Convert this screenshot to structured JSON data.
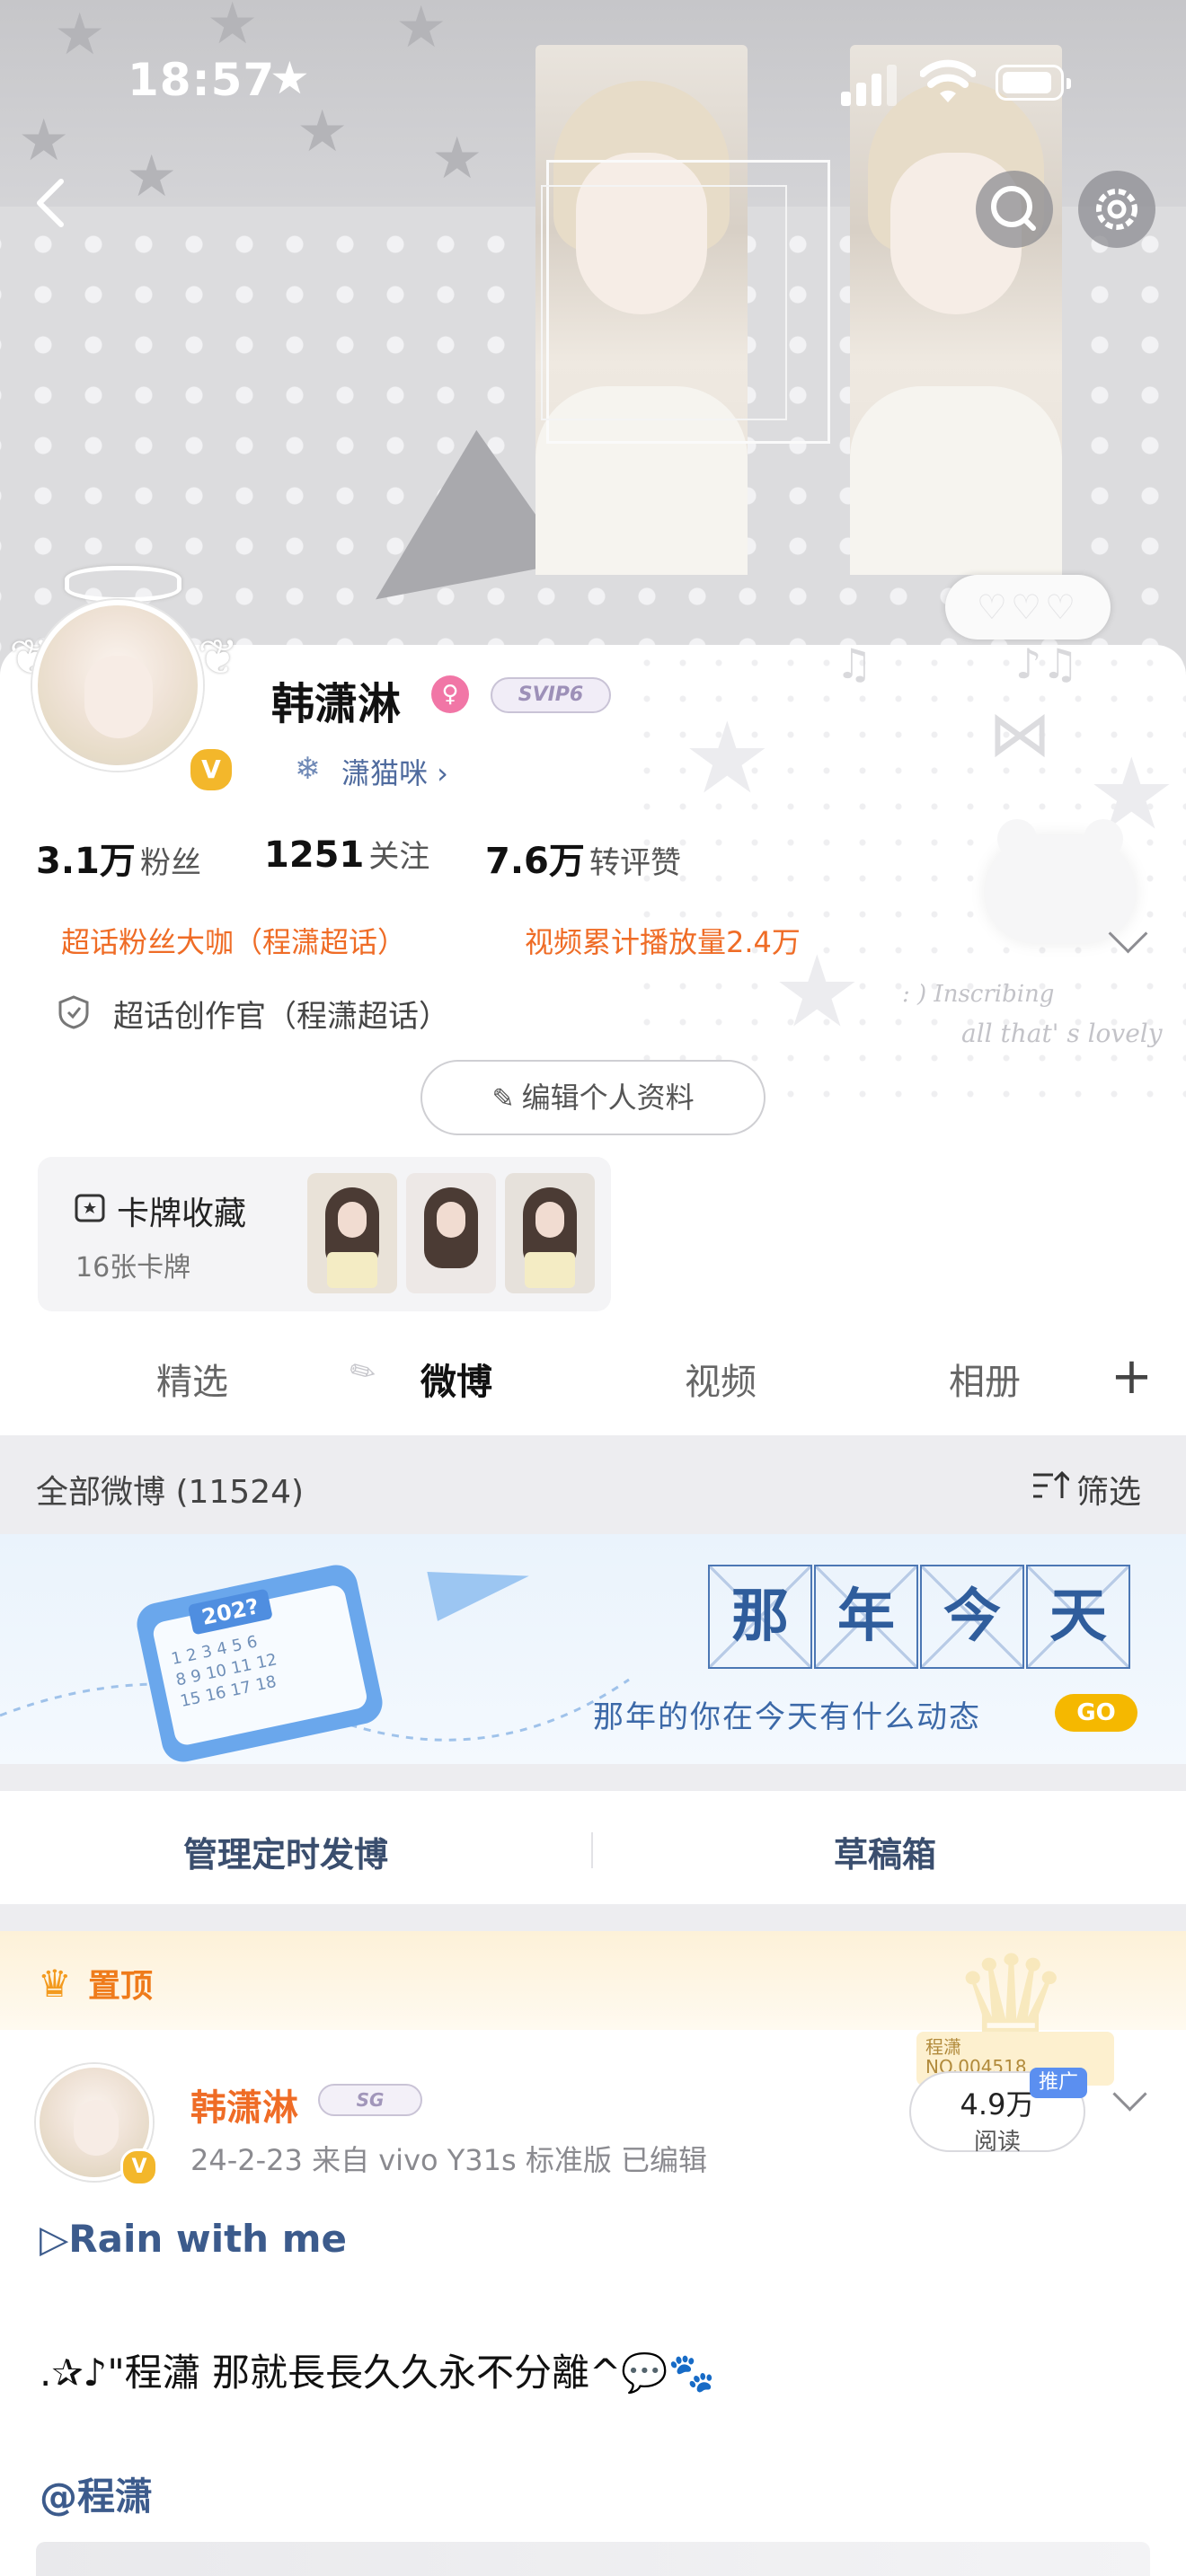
{
  "status_bar": {
    "time": "18:57"
  },
  "profile": {
    "name": "韩潇淋",
    "svip_badge": "SVIP6",
    "sub_name": "潇猫咪 ›",
    "stats": [
      {
        "num": "3.1万",
        "label": "粉丝"
      },
      {
        "num": "1251",
        "label": "关注"
      },
      {
        "num": "7.6万",
        "label": "转评赞"
      }
    ],
    "honors": [
      "超话粉丝大咖（程潇超话）",
      "视频累计播放量2.4万"
    ],
    "creator": "超话创作官（程潇超话）",
    "edit_button": "编辑个人资料",
    "decor_text_1": ": ) Inscribing",
    "decor_text_2": "all that' s lovely"
  },
  "cards": {
    "title": "卡牌收藏",
    "count": "16张卡牌"
  },
  "tabs": [
    {
      "label": "精选"
    },
    {
      "label": "微博"
    },
    {
      "label": "视频"
    },
    {
      "label": "相册"
    }
  ],
  "feed": {
    "all_label": "全部微博 (11524)",
    "filter_label": "筛选"
  },
  "nn_banner": {
    "year": "202?",
    "chars": [
      "那",
      "年",
      "今",
      "天"
    ],
    "text": "那年的你在今天有什么动态",
    "go": "GO"
  },
  "actions": {
    "scheduled": "管理定时发博",
    "drafts": "草稿箱"
  },
  "pinned_post": {
    "pinned_label": "置顶",
    "author": "韩潇淋",
    "badge": "SG",
    "meta": "24-2-23  来自 vivo Y31s 标准版  已编辑",
    "reads": "4.9万",
    "reads_label": "阅读",
    "promo_tag": "推广",
    "ticket_name": "程潇",
    "ticket_no": "NO.004518",
    "line1": "▷Rain with me",
    "line2": ".✰♪\"程瀟 那就長長久久永不分離^💬🐾",
    "line3": "@程潇"
  }
}
